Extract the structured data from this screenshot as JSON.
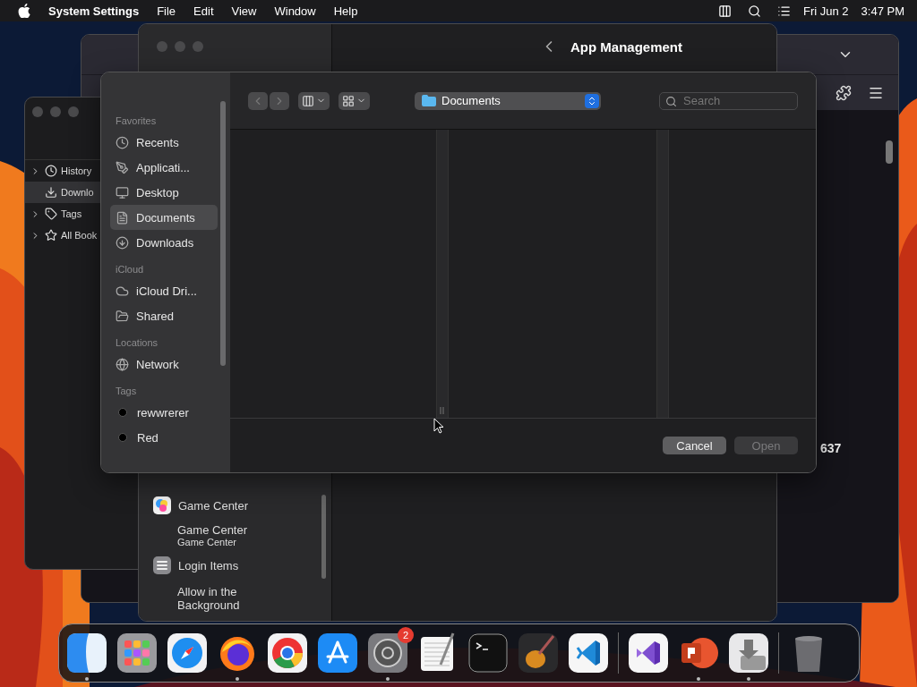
{
  "menu_bar": {
    "app_name": "System Settings",
    "menus": [
      "File",
      "Edit",
      "View",
      "Window",
      "Help"
    ],
    "date": "Fri Jun 2",
    "time": "3:47 PM"
  },
  "browser_window": {
    "fragment": "637"
  },
  "library_window": {
    "items": [
      {
        "label": "History",
        "has_children": true,
        "selected": false
      },
      {
        "label": "Downlo",
        "has_children": false,
        "selected": true
      },
      {
        "label": "Tags",
        "has_children": true,
        "selected": false
      },
      {
        "label": "All Book",
        "has_children": true,
        "selected": false
      }
    ]
  },
  "settings_window": {
    "title": "App Management",
    "sidebar": [
      {
        "kind": "app",
        "label": "Game Center"
      },
      {
        "kind": "sub",
        "title": "Game Center",
        "subtitle": "Game Center"
      },
      {
        "kind": "app",
        "label": "Login Items"
      },
      {
        "kind": "detail",
        "label": "Allow in the Background"
      }
    ]
  },
  "open_dialog": {
    "location": "Documents",
    "search": {
      "placeholder": "Search"
    },
    "sidebar": [
      {
        "heading": "Favorites",
        "items": [
          {
            "label": "Recents",
            "selected": false
          },
          {
            "label": "Applicati...",
            "selected": false
          },
          {
            "label": "Desktop",
            "selected": false
          },
          {
            "label": "Documents",
            "selected": true
          },
          {
            "label": "Downloads",
            "selected": false
          }
        ]
      },
      {
        "heading": "iCloud",
        "items": [
          {
            "label": "iCloud Dri...",
            "selected": false
          },
          {
            "label": "Shared",
            "selected": false
          }
        ]
      },
      {
        "heading": "Locations",
        "items": [
          {
            "label": "Network",
            "selected": false
          }
        ]
      },
      {
        "heading": "Tags",
        "items": [
          {
            "label": "rewwrerer",
            "selected": false,
            "color": "#000000"
          },
          {
            "label": "Red",
            "selected": false,
            "color": "#000000"
          }
        ]
      }
    ],
    "buttons": [
      {
        "label": "Cancel",
        "disabled": false
      },
      {
        "label": "Open",
        "disabled": true
      }
    ]
  },
  "dock": {
    "items": [
      {
        "kind": "finder",
        "running": true
      },
      {
        "kind": "launchpad",
        "running": false
      },
      {
        "kind": "safari",
        "running": false
      },
      {
        "kind": "firefox",
        "running": true
      },
      {
        "kind": "chrome",
        "running": false
      },
      {
        "kind": "appstore",
        "running": false
      },
      {
        "kind": "settings",
        "running": true,
        "badge": "2"
      },
      {
        "kind": "textedit",
        "running": false
      },
      {
        "kind": "terminal",
        "running": false
      },
      {
        "kind": "garageband",
        "running": false
      },
      {
        "kind": "vscode",
        "running": false
      },
      {
        "kind": "separator"
      },
      {
        "kind": "visualstudio",
        "running": false
      },
      {
        "kind": "powerpoint",
        "running": true
      },
      {
        "kind": "installer",
        "running": true
      },
      {
        "kind": "separator"
      },
      {
        "kind": "trash",
        "running": false
      }
    ]
  }
}
